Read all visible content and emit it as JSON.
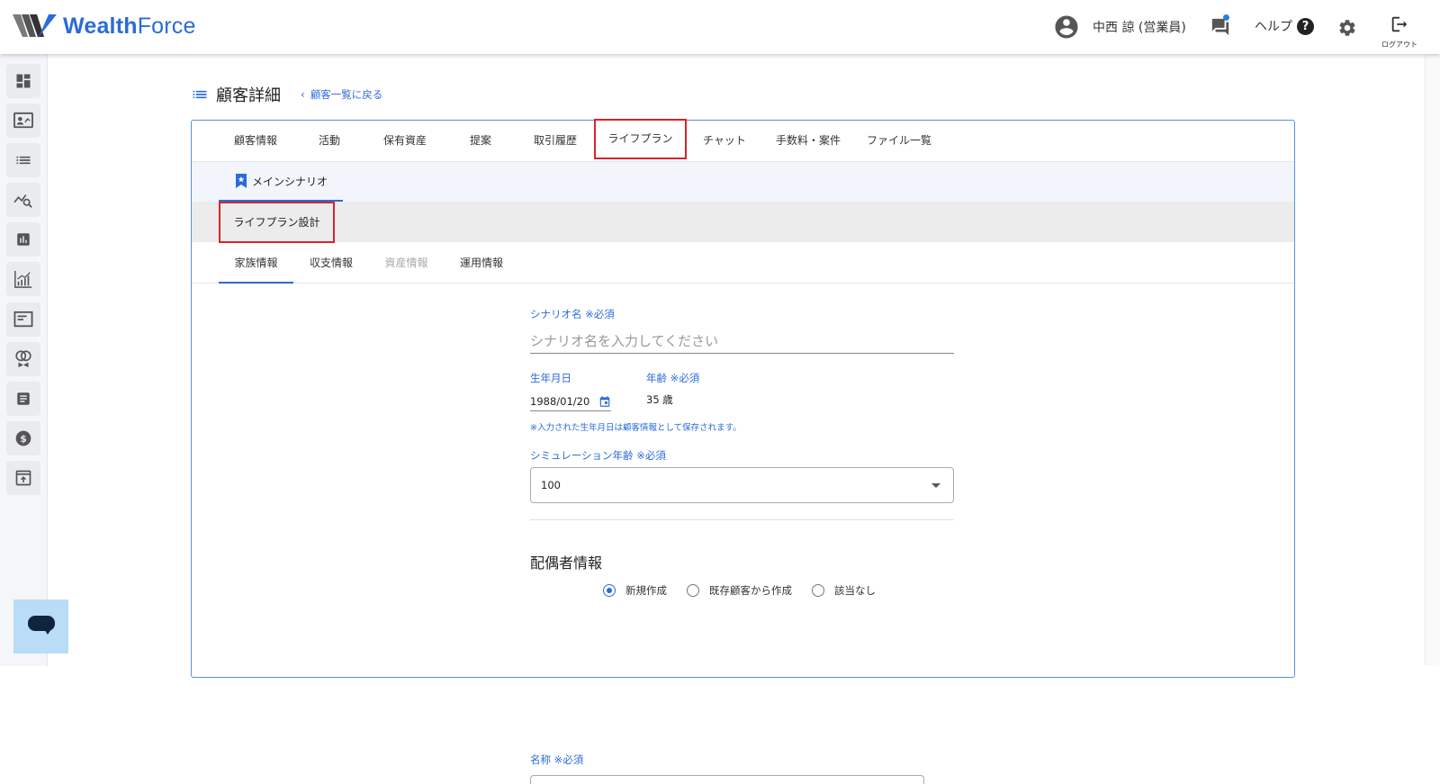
{
  "header": {
    "logo_bold": "Wealth",
    "logo_regular": "Force",
    "user_name": "中西 諒 (営業員)",
    "help_label": "ヘルプ",
    "logout_label": "ログアウト"
  },
  "sidebar": {
    "items": [
      "dashboard",
      "customer-card",
      "list",
      "analytics-search",
      "bar-chart",
      "growth-chart",
      "notice",
      "life-event",
      "document",
      "commission",
      "upload"
    ]
  },
  "page": {
    "title": "顧客詳細",
    "back_link": "顧客一覧に戻る"
  },
  "main_tabs": [
    "顧客情報",
    "活動",
    "保有資産",
    "提案",
    "取引履歴",
    "ライフプラン",
    "チャット",
    "手数料・案件",
    "ファイル一覧"
  ],
  "scenario_tab": "メインシナリオ",
  "design_button": "ライフプラン設計",
  "sub_tabs": [
    "家族情報",
    "収支情報",
    "資産情報",
    "運用情報"
  ],
  "form": {
    "scenario_label": "シナリオ名 ※必須",
    "scenario_placeholder": "シナリオ名を入力してください",
    "birth_label": "生年月日",
    "birth_value": "1988/01/20",
    "age_label": "年齢 ※必須",
    "age_value": "35 歳",
    "birth_note": "※入力された生年月日は顧客情報として保存されます。",
    "sim_age_label": "シミュレーション年齢 ※必須",
    "sim_age_value": "100",
    "spouse_title": "配偶者情報",
    "radio_options": [
      "新規作成",
      "既存顧客から作成",
      "該当なし"
    ],
    "selected_radio": "新規作成",
    "name_label": "名称 ※必須"
  },
  "colors": {
    "brand": "#2b6bd9",
    "highlight": "#d8232a",
    "chat_fab": "#b9dcf7"
  }
}
